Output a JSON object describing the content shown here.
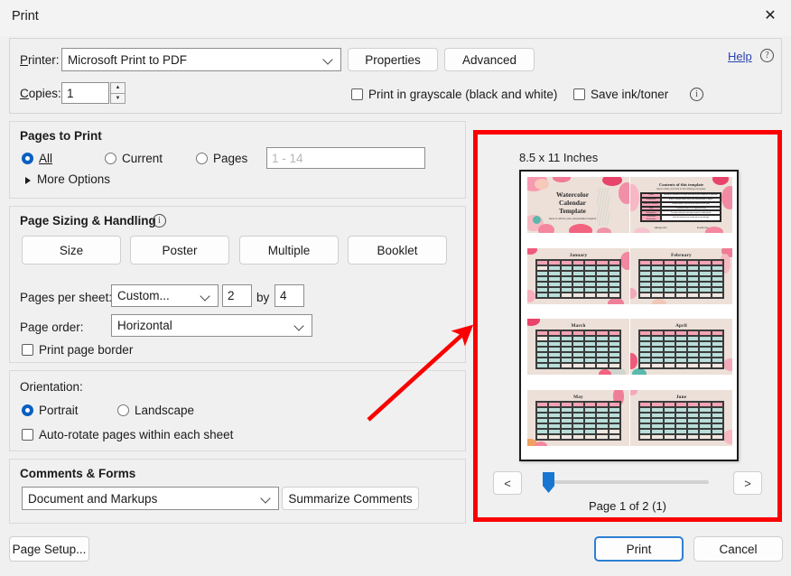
{
  "window": {
    "title": "Print",
    "close_label": "✕"
  },
  "printer": {
    "label": "Printer:",
    "label_underline": "P",
    "value": "Microsoft Print to PDF",
    "properties_label": "Properties",
    "advanced_label": "Advanced",
    "help_label": "Help",
    "help_icon_glyph": "?"
  },
  "copies": {
    "label": "Copies:",
    "value": "1",
    "up_glyph": "▲",
    "down_glyph": "▼"
  },
  "options": {
    "grayscale_label": "Print in grayscale (black and white)",
    "grayscale_checked": false,
    "save_ink_label": "Save ink/toner",
    "save_ink_checked": false,
    "info_icon_glyph": "i"
  },
  "pages_to_print": {
    "title": "Pages to Print",
    "all_label": "All",
    "current_label": "Current",
    "pages_label": "Pages",
    "selected": "All",
    "range_placeholder": "1 - 14",
    "range_value": "",
    "more_options_label": "More Options"
  },
  "page_sizing": {
    "title": "Page Sizing & Handling",
    "info_icon_glyph": "i",
    "buttons": [
      {
        "label": "Size"
      },
      {
        "label": "Poster"
      },
      {
        "label": "Multiple"
      },
      {
        "label": "Booklet"
      }
    ],
    "pages_per_sheet_label": "Pages per sheet:",
    "pages_per_sheet_value": "Custom...",
    "cols_value": "2",
    "by_label": "by",
    "rows_value": "4",
    "page_order_label": "Page order:",
    "page_order_value": "Horizontal",
    "print_page_border_label": "Print page border",
    "print_page_border_checked": false
  },
  "orientation": {
    "title": "Orientation:",
    "portrait_label": "Portrait",
    "landscape_label": "Landscape",
    "selected": "Portrait",
    "auto_rotate_label": "Auto-rotate pages within each sheet",
    "auto_rotate_checked": false
  },
  "comments_forms": {
    "title": "Comments & Forms",
    "value": "Document and Markups",
    "summarize_label": "Summarize Comments"
  },
  "footer": {
    "page_setup_label": "Page Setup...",
    "print_label": "Print",
    "cancel_label": "Cancel"
  },
  "preview": {
    "paper_size_label": "8.5 x 11 Inches",
    "prev_glyph": "<",
    "next_glyph": ">",
    "page_info": "Page 1 of 2 (1)",
    "slides": [
      {
        "kind": "title",
        "line1": "Watercolor",
        "line2": "Calendar",
        "line3": "Template",
        "sub": "Here is where your presentation begins"
      },
      {
        "kind": "toc",
        "title": "Contents of this template",
        "subtitle": "Here's what you'll find in this Slidesgo template:",
        "rows": [
          {
            "k": "Cover",
            "v": "A slide to introduce the topic and catch your audience's attention"
          },
          {
            "k": "Introduction",
            "v": "A bit of context about what this presentation is about"
          },
          {
            "k": "Monthly calendars",
            "v": "Twelve slides, one for each month of the year"
          },
          {
            "k": "Table",
            "v": "To present data in an organized way"
          },
          {
            "k": "Infographics",
            "v": "To make relevant concepts easier to understand"
          },
          {
            "k": "Icons and illustrations",
            "v": "Lots of resources to create your own design"
          }
        ],
        "links": [
          "slidesgo.com",
          "freepik.com"
        ]
      },
      {
        "kind": "month",
        "name": "January"
      },
      {
        "kind": "month",
        "name": "February"
      },
      {
        "kind": "month",
        "name": "March"
      },
      {
        "kind": "month",
        "name": "April"
      },
      {
        "kind": "month",
        "name": "May"
      },
      {
        "kind": "month",
        "name": "June"
      }
    ]
  },
  "colors": {
    "accent_blue": "#0b5fc1",
    "annotation_red": "#fb0000",
    "paper_beige": "#ece0d8",
    "calendar_header_pink": "#f5a3b5",
    "calendar_cell_teal": "#b9ded9",
    "link_blue": "#2b44b0"
  }
}
